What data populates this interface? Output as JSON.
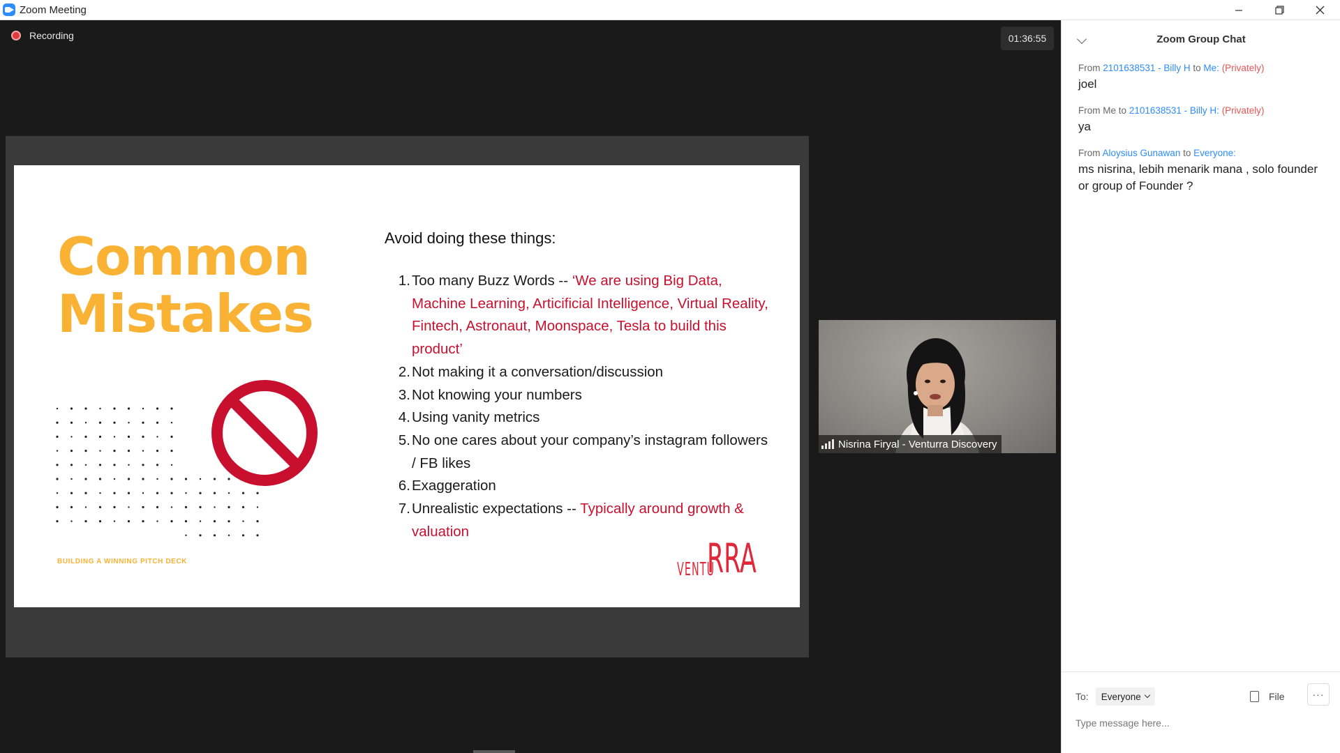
{
  "window": {
    "title": "Zoom Meeting"
  },
  "meeting": {
    "recording_label": "Recording",
    "timer": "01:36:55"
  },
  "slide": {
    "title_line1": "Common",
    "title_line2": "Mistakes",
    "deck_label": "BUILDING A WINNING PITCH DECK",
    "heading": "Avoid doing these things:",
    "items": [
      {
        "num": "1.",
        "text": "Too many Buzz Words -- ",
        "highlight": "‘We are using Big Data, Machine Learning, Articificial Intelligence, Virtual Reality, Fintech, Astronaut, Moonspace, Tesla to build this product’"
      },
      {
        "num": "2.",
        "text": "Not making it a conversation/discussion",
        "highlight": ""
      },
      {
        "num": "3.",
        "text": "Not knowing your numbers",
        "highlight": ""
      },
      {
        "num": "4.",
        "text": "Using vanity metrics",
        "highlight": ""
      },
      {
        "num": "5.",
        "text": "No one cares about your company’s instagram followers / FB likes",
        "highlight": ""
      },
      {
        "num": "6.",
        "text": "Exaggeration",
        "highlight": ""
      },
      {
        "num": "7.",
        "text": "Unrealistic expectations -- ",
        "highlight": "Typically around growth & valuation"
      }
    ],
    "logo_small": "VENTU",
    "logo_big": "RRA",
    "colors": {
      "title": "#F9B233",
      "highlight": "#C8102E",
      "logo": "#E0283A"
    }
  },
  "video": {
    "participant_name": "Nisrina Firyal - Venturra Discovery"
  },
  "chat": {
    "title": "Zoom Group Chat",
    "messages": [
      {
        "from_label": "From",
        "sender": "2101638531 - Billy H",
        "to_label": "to",
        "recipient": "Me:",
        "private": "(Privately)",
        "text": "joel"
      },
      {
        "from_label": "From",
        "sender": "Me",
        "to_label": "to",
        "recipient": "2101638531 - Billy H:",
        "private": "(Privately)",
        "text": "ya"
      },
      {
        "from_label": "From",
        "sender": "Aloysius Gunawan",
        "to_label": "to",
        "recipient": "Everyone:",
        "private": "",
        "text": "ms nisrina, lebih menarik mana  , solo founder or group of Founder ?"
      }
    ],
    "to_label": "To:",
    "to_value": "Everyone",
    "file_label": "File",
    "more_label": "···",
    "input_placeholder": "Type message here...",
    "link_color": "#2D8CFF",
    "private_color": "#e85454"
  }
}
